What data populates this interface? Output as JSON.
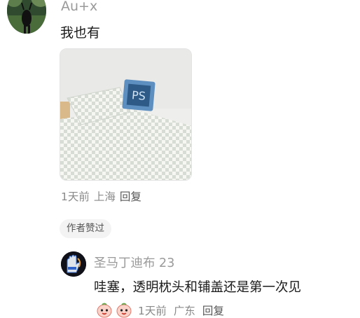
{
  "comment": {
    "username": "Au+x",
    "text": "我也有",
    "meta": {
      "time": "1天前",
      "location": "上海",
      "reply_label": "回复"
    },
    "author_badge": "作者赞过"
  },
  "reply": {
    "username": "圣马丁迪布 23",
    "text": "哇塞，透明枕头和铺盖还是第一次见",
    "emojis": [
      "peach-face-emoji",
      "peach-face-emoji"
    ],
    "meta": {
      "time": "1天前",
      "location": "广东",
      "reply_label": "回复"
    }
  },
  "colors": {
    "secondary_text": "#8a8a8a",
    "primary_text": "#1a1a1a",
    "badge_bg": "#f3f3f3"
  }
}
